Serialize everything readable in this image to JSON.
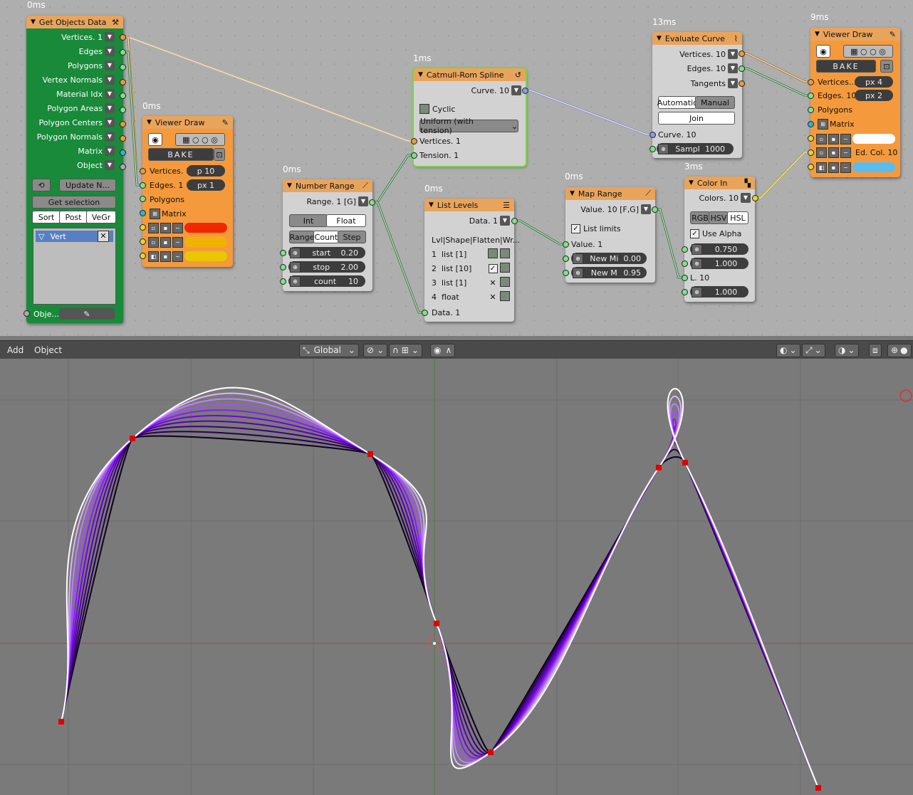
{
  "node_editor": {
    "top_timing": "0ms",
    "get_objects": {
      "title": "Get Objects Data",
      "outputs": [
        "Vertices. 1",
        "Edges",
        "Polygons",
        "Vertex Normals",
        "Material Idx",
        "Polygon Areas",
        "Polygon Centers",
        "Polygon Normals",
        "Matrix",
        "Object"
      ],
      "update_label": "Update N...",
      "get_selection": "Get selection",
      "tabs": [
        "Sort",
        "Post",
        "VeGr"
      ],
      "list_item": "Vert",
      "object_input": "Obje..."
    },
    "viewer_draw_1": {
      "timing": "0ms",
      "title": "Viewer Draw",
      "bake": "BAKE",
      "inputs": [
        "Vertices. 1",
        "Edges. 1",
        "Polygons",
        "Matrix"
      ],
      "vert_size": "p  10",
      "edge_size": "px  1",
      "colors": [
        "#f02800",
        "#f0b400",
        "#e8c800"
      ]
    },
    "number_range": {
      "timing": "0ms",
      "title": "Number Range",
      "output": "Range. 1 [G]",
      "mode_tabs": [
        "Int",
        "Float"
      ],
      "range_tabs": [
        "Range",
        "Count",
        "Step"
      ],
      "fields": [
        {
          "label": "start",
          "value": "0.20"
        },
        {
          "label": "stop",
          "value": "2.00"
        },
        {
          "label": "count",
          "value": "10"
        }
      ]
    },
    "catmull": {
      "timing": "1ms",
      "title": "Catmull-Rom Spline",
      "output": "Curve. 10",
      "cyclic": "Cyclic",
      "mode": "Uniform (with tension)",
      "inputs": [
        "Vertices. 1",
        "Tension. 1"
      ]
    },
    "list_levels": {
      "timing": "0ms",
      "title": "List Levels",
      "output": "Data. 1",
      "header": "Lvl|Shape|Flatten|Wr...",
      "rows": [
        {
          "lvl": "1",
          "shape": "list [1]",
          "checked": false,
          "x": false
        },
        {
          "lvl": "2",
          "shape": "list [10]",
          "checked": true,
          "x": false
        },
        {
          "lvl": "3",
          "shape": "list [1]",
          "checked": false,
          "x": true
        },
        {
          "lvl": "4",
          "shape": "float",
          "checked": false,
          "x": true
        }
      ],
      "input": "Data. 1"
    },
    "map_range": {
      "timing": "0ms",
      "title": "Map Range",
      "output": "Value. 10 [F,G]",
      "list_limits": "List limits",
      "input": "Value. 1",
      "fields": [
        {
          "label": "New Mi",
          "value": "0.00"
        },
        {
          "label": "New M",
          "value": "0.95"
        }
      ]
    },
    "evaluate_curve": {
      "timing": "13ms",
      "title": "Evaluate Curve",
      "outputs": [
        "Vertices. 10",
        "Edges. 10",
        "Tangents"
      ],
      "mode_tabs": [
        "Automatic",
        "Manual"
      ],
      "join": "Join",
      "input": "Curve. 10",
      "sample": {
        "label": "Sampl",
        "value": "1000"
      }
    },
    "color_in": {
      "timing": "3ms",
      "title": "Color In",
      "output": "Colors. 10",
      "mode_tabs": [
        "RGB",
        "HSV",
        "HSL"
      ],
      "use_alpha": "Use Alpha",
      "values": [
        "0.750",
        "1.000"
      ],
      "l_input": "L. 10",
      "alpha": "1.000"
    },
    "viewer_draw_2": {
      "timing": "9ms",
      "title": "Viewer Draw",
      "bake": "BAKE",
      "inputs": [
        "Vertices....",
        "Edges. 10",
        "Polygons",
        "Matrix"
      ],
      "vert_size": "px  4",
      "edge_size": "px  2",
      "edge_col_label": "Ed. Col. 10",
      "colors": [
        "#ffffff",
        "#5cbcef"
      ]
    }
  },
  "toolbar": {
    "add": "Add",
    "object": "Object",
    "orientation": "Global"
  }
}
